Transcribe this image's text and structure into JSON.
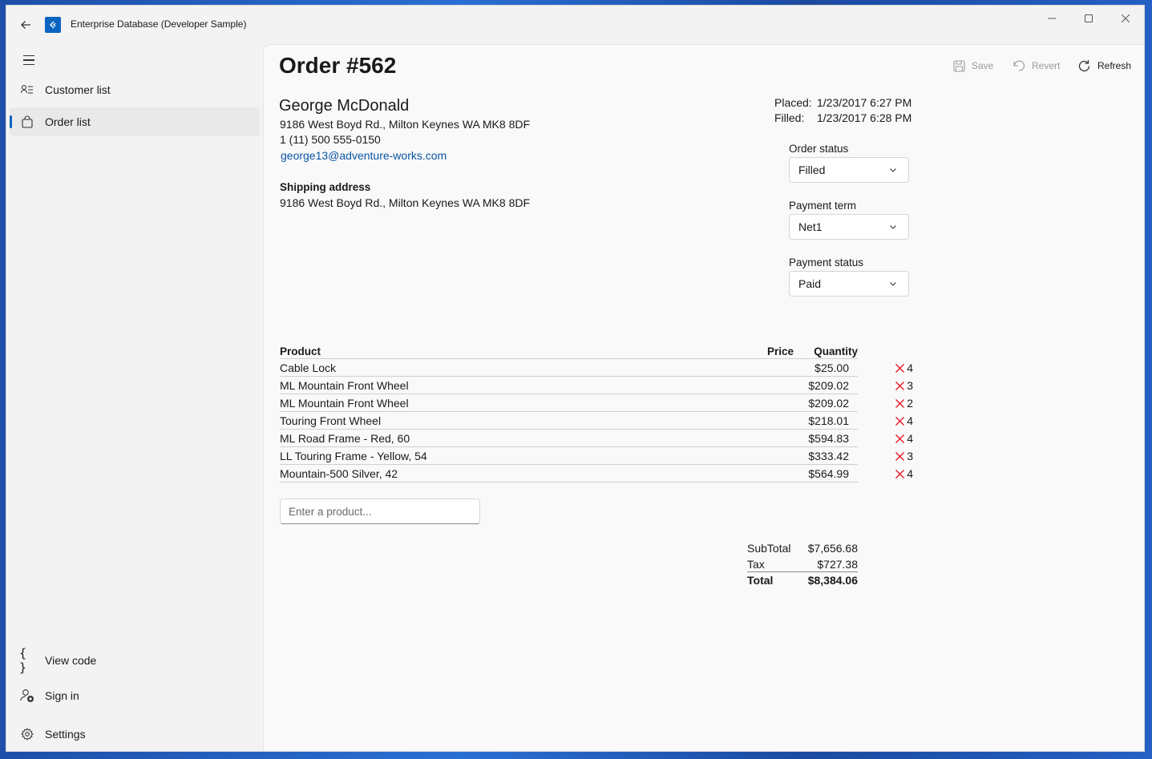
{
  "app": {
    "title": "Enterprise Database (Developer Sample)"
  },
  "nav": {
    "items": [
      {
        "label": "Customer list"
      },
      {
        "label": "Order list"
      }
    ],
    "footer": [
      {
        "label": "View code"
      },
      {
        "label": "Sign in"
      },
      {
        "label": "Settings"
      }
    ]
  },
  "order": {
    "title": "Order #562",
    "commands": {
      "save": "Save",
      "revert": "Revert",
      "refresh": "Refresh"
    },
    "customer": {
      "name": "George McDonald",
      "address": "9186 West Boyd Rd., Milton Keynes WA MK8 8DF",
      "phone": "1 (11) 500 555-0150",
      "email": "george13@adventure-works.com"
    },
    "shipping": {
      "label": "Shipping address",
      "address": "9186 West Boyd Rd., Milton Keynes WA MK8 8DF"
    },
    "dates": {
      "placed_label": "Placed:",
      "placed": "1/23/2017 6:27 PM",
      "filled_label": "Filled:",
      "filled": "1/23/2017 6:28 PM"
    },
    "order_status": {
      "label": "Order status",
      "value": "Filled"
    },
    "payment_term": {
      "label": "Payment term",
      "value": "Net1"
    },
    "payment_status": {
      "label": "Payment status",
      "value": "Paid"
    },
    "table": {
      "headers": {
        "product": "Product",
        "price": "Price",
        "quantity": "Quantity"
      },
      "rows": [
        {
          "product": "Cable Lock",
          "price": "$25.00",
          "quantity": "4"
        },
        {
          "product": "ML Mountain Front Wheel",
          "price": "$209.02",
          "quantity": "3"
        },
        {
          "product": "ML Mountain Front Wheel",
          "price": "$209.02",
          "quantity": "2"
        },
        {
          "product": "Touring Front Wheel",
          "price": "$218.01",
          "quantity": "4"
        },
        {
          "product": "ML Road Frame - Red, 60",
          "price": "$594.83",
          "quantity": "4"
        },
        {
          "product": "LL Touring Frame - Yellow, 54",
          "price": "$333.42",
          "quantity": "3"
        },
        {
          "product": "Mountain-500 Silver, 42",
          "price": "$564.99",
          "quantity": "4"
        }
      ]
    },
    "add_product_placeholder": "Enter a product...",
    "totals": {
      "subtotal_label": "SubTotal",
      "subtotal": "$7,656.68",
      "tax_label": "Tax",
      "tax": "$727.38",
      "total_label": "Total",
      "total": "$8,384.06"
    }
  },
  "colors": {
    "accent": "#0a64c2",
    "delete": "#e81123",
    "link": "#0a55a6"
  }
}
